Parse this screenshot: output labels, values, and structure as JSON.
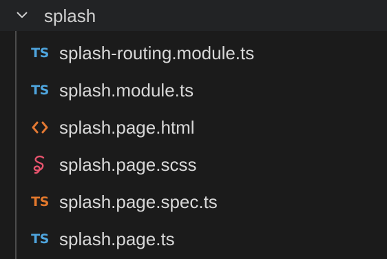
{
  "colors": {
    "background": "#1b1b1b",
    "folder_row_bg": "#222325",
    "ts_blue": "#4fa6df",
    "ts_spec_orange": "#e5792c",
    "html_orange": "#e37933",
    "scss_pink": "#e8546e",
    "text": "#d8d8d8"
  },
  "folder": {
    "name": "splash",
    "expanded": true,
    "icon": "chevron-down-icon"
  },
  "files": [
    {
      "name": "splash-routing.module.ts",
      "icon": "typescript-icon",
      "glyph": "TS",
      "color": "#4fa6df"
    },
    {
      "name": "splash.module.ts",
      "icon": "typescript-icon",
      "glyph": "TS",
      "color": "#4fa6df"
    },
    {
      "name": "splash.page.html",
      "icon": "html-icon",
      "glyph": "<>",
      "color": "#e37933"
    },
    {
      "name": "splash.page.scss",
      "icon": "sass-icon",
      "glyph": "",
      "color": "#e8546e"
    },
    {
      "name": "splash.page.spec.ts",
      "icon": "typescript-test-icon",
      "glyph": "TS",
      "color": "#e5792c"
    },
    {
      "name": "splash.page.ts",
      "icon": "typescript-icon",
      "glyph": "TS",
      "color": "#4fa6df"
    }
  ]
}
